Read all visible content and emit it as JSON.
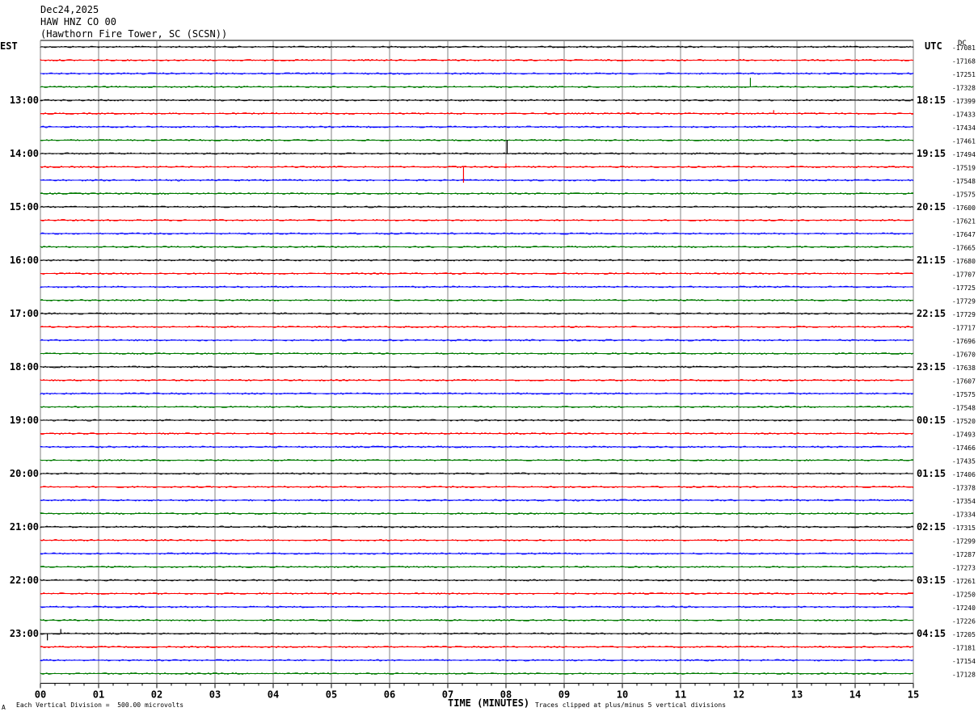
{
  "header": {
    "date": "Dec24,2025",
    "station": "HAW HNZ CO 00",
    "location": "(Hawthorn Fire Tower, SC (SCSN))"
  },
  "left_tz": "EST",
  "right_tz": "UTC",
  "right_unit": "DC",
  "footer": {
    "division_note": "Each Vertical Division =  500.00 microvolts",
    "clip_note": "Traces clipped at plus/minus 5 vertical divisions",
    "corner_mark": "A"
  },
  "chart_data": {
    "type": "line",
    "xlabel": "TIME (MINUTES)",
    "x_ticks": [
      "00",
      "01",
      "02",
      "03",
      "04",
      "05",
      "06",
      "07",
      "08",
      "09",
      "10",
      "11",
      "12",
      "13",
      "14",
      "15"
    ],
    "xlim": [
      0,
      15
    ],
    "trace_colors": [
      "#000000",
      "#ff0000",
      "#0000ff",
      "#007a00"
    ],
    "rows_per_hour": 4,
    "left_hour_labels": [
      "13:00",
      "14:00",
      "15:00",
      "16:00",
      "17:00",
      "18:00",
      "19:00",
      "20:00",
      "21:00",
      "22:00",
      "23:00"
    ],
    "right_hour_labels": [
      "18:15",
      "19:15",
      "20:15",
      "21:15",
      "22:15",
      "23:15",
      "00:15",
      "01:15",
      "02:15",
      "03:15",
      "04:15"
    ],
    "dc_offsets": [
      "-17081",
      "-17168",
      "-17251",
      "-17328",
      "-17399",
      "-17433",
      "-17434",
      "-17461",
      "-17494",
      "-17519",
      "-17548",
      "-17575",
      "-17600",
      "-17621",
      "-17647",
      "-17665",
      "-17680",
      "-17707",
      "-17725",
      "-17729",
      "-17729",
      "-17717",
      "-17696",
      "-17670",
      "-17638",
      "-17607",
      "-17575",
      "-17548",
      "-17520",
      "-17493",
      "-17466",
      "-17435",
      "-17406",
      "-17378",
      "-17354",
      "-17334",
      "-17315",
      "-17299",
      "-17287",
      "-17273",
      "-17261",
      "-17250",
      "-17240",
      "-17226",
      "-17205",
      "-17181",
      "-17154",
      "-17128"
    ],
    "events": [
      {
        "trace": 3,
        "minute": 12.2,
        "amplitude": 8
      },
      {
        "trace": 5,
        "minute": 12.6,
        "amplitude": 3
      },
      {
        "trace": 8,
        "minute": 8.02,
        "amplitude": 12
      },
      {
        "trace": 9,
        "minute": 7.27,
        "amplitude": -14
      },
      {
        "trace": 9,
        "minute": 8.0,
        "amplitude": 3
      },
      {
        "trace": 44,
        "minute": 0.12,
        "amplitude": -6
      },
      {
        "trace": 44,
        "minute": 0.35,
        "amplitude": 4
      }
    ]
  }
}
